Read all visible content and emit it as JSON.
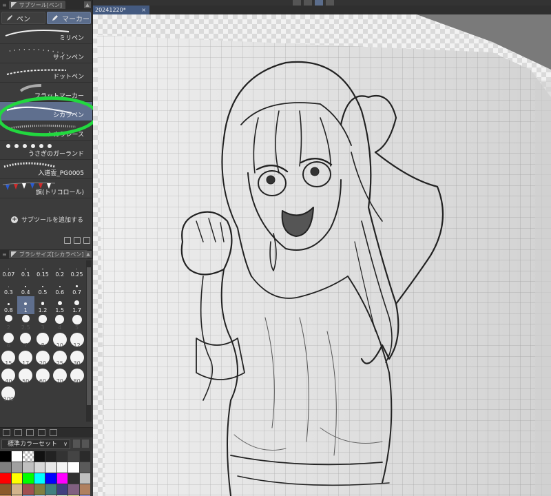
{
  "subtool_panel": {
    "title": "サブツール[ペン]",
    "tabs": [
      {
        "label": "ペン",
        "active": false
      },
      {
        "label": "マーカー",
        "active": true
      }
    ],
    "items": [
      {
        "label": "ミリペン",
        "stroke": "line"
      },
      {
        "label": "サインペン",
        "stroke": "dots"
      },
      {
        "label": "ドットペン",
        "stroke": "dotted-line"
      },
      {
        "label": "フラットマーカー",
        "stroke": "flat"
      },
      {
        "label": "シカラペン",
        "stroke": "taper",
        "selected": true
      },
      {
        "label": "シカラレース",
        "stroke": "lace"
      },
      {
        "label": "うさぎのガーランド",
        "stroke": "bunnies"
      },
      {
        "label": "入道雲_PG0005",
        "stroke": "cloud"
      },
      {
        "label": "旗(トリコロール)",
        "stroke": "flags"
      }
    ],
    "add_label": "サブツールを追加する",
    "highlight_color": "#22d83f"
  },
  "brush_size_panel": {
    "title": "ブラシサイズ[シカラペン]",
    "sizes": [
      "0.07",
      "0.1",
      "0.15",
      "0.2",
      "0.25",
      "0.3",
      "0.4",
      "0.5",
      "0.6",
      "0.7",
      "0.8",
      "1",
      "1.2",
      "1.5",
      "1.7",
      "2",
      "2.5",
      "3",
      "4",
      "5",
      "6",
      "7",
      "8",
      "10",
      "12",
      "15",
      "17",
      "20",
      "25",
      "30",
      "40",
      "50",
      "60",
      "70",
      "80",
      "100"
    ],
    "selected": "1"
  },
  "color_set_panel": {
    "set_name": "標準カラーセット",
    "swatches": [
      "#000000",
      "#ffffff",
      "checker",
      "#111111",
      "#222222",
      "#333333",
      "#444444",
      "#2b2b2b",
      "#7f7f7f",
      "#a0a0a0",
      "#c0c0c0",
      "#d8d8d8",
      "#e8e8e8",
      "#f4f4f4",
      "#ffffff",
      "#5a5a5a",
      "#ff0000",
      "#ffff00",
      "#00ff00",
      "#00ffff",
      "#0000ff",
      "#ff00ff",
      "#303030",
      "#c0c0c0",
      "#8b5a2b",
      "#d2b48c",
      "#a05050",
      "#808040",
      "#408080",
      "#404080",
      "#806080",
      "#b08060",
      "#e0a060",
      "#f0d0a0",
      "#80b0e0",
      "#c0e0ff",
      "#ffe0e0",
      "#e0ffe0",
      "#f0f0a0",
      "#a0a0f0"
    ]
  },
  "document": {
    "tab_title": "20241220*",
    "close_glyph": "×"
  }
}
